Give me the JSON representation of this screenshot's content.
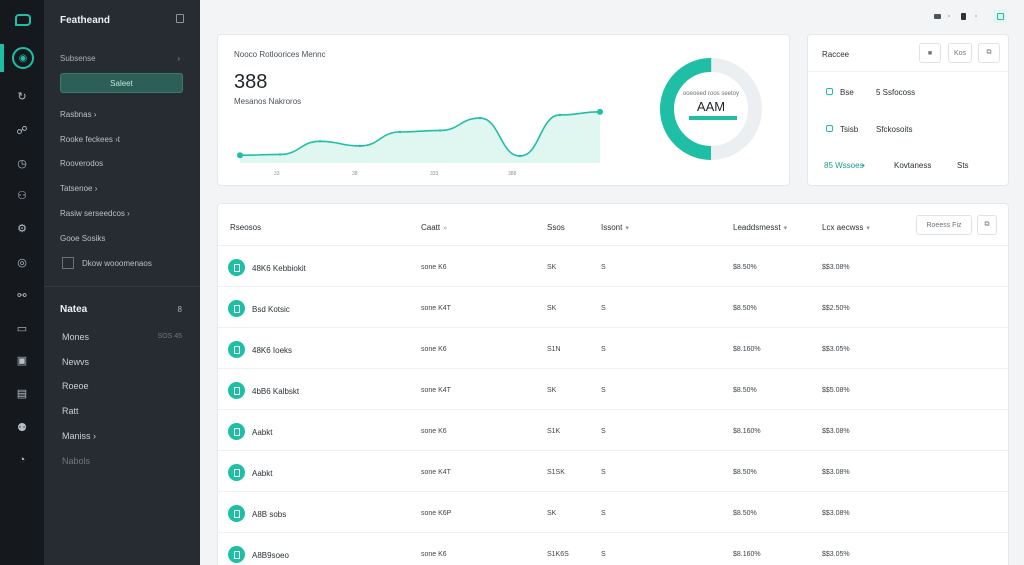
{
  "sidebar": {
    "title": "Featheand",
    "section": "Subsense",
    "section_chevron": "›",
    "primary_button": "Saleet",
    "items": [
      "Rasbnas ›",
      "Rooke feckees ›t",
      "Rooverodos",
      "Tatsenoe ›",
      "Rasiw serseedcos ›",
      "Gooe Sosiks",
      "Dkow wooomenaos"
    ],
    "group_title": "Natea",
    "group_count": "8",
    "subitems": [
      {
        "label": "Mones",
        "meta": "SOS 45"
      },
      {
        "label": "Newvs",
        "meta": ""
      },
      {
        "label": "Roeoe",
        "meta": ""
      },
      {
        "label": "Ratt",
        "meta": ""
      },
      {
        "label": "Maniss ›",
        "meta": ""
      },
      {
        "label": "Nabols",
        "meta": ""
      }
    ]
  },
  "metric_card": {
    "title": "Nooco Rotloorices Mennc",
    "value": "388",
    "subtitle": "Mesanos Nakroros"
  },
  "chart_data": {
    "type": "area",
    "x": [
      0,
      1,
      2,
      3,
      4,
      5,
      6,
      7,
      8,
      9
    ],
    "values": [
      10,
      11,
      28,
      22,
      40,
      42,
      58,
      9,
      62,
      66
    ],
    "tick_labels": [
      "33",
      "38",
      "333",
      "388"
    ],
    "ylim": [
      0,
      80
    ],
    "grid": false,
    "legend": "none",
    "title": "",
    "xlabel": "",
    "ylabel": ""
  },
  "donut": {
    "label": "ooeoeed roos seetoy",
    "value": "AAM",
    "percent": 50
  },
  "side_card": {
    "title": "Raccee",
    "btn_label": "Kos",
    "rows": [
      {
        "a": "Bse",
        "b": "5 Ssfocoss"
      },
      {
        "a": "Tsisb",
        "b": "Sfckosoits"
      }
    ],
    "footer": {
      "a": "85 Wssoes",
      "b": "Kovtaness",
      "c": "Sts"
    }
  },
  "table": {
    "columns": [
      "Rseosos",
      "Caatt",
      "Ssos",
      "Issont",
      "Leaddsmesst",
      "Lcx aecwss"
    ],
    "sort_glyph": "▾",
    "sort_glyph_alt": "»",
    "filter_label": "Roeess Fiz",
    "rows": [
      {
        "name": "48K6 Kebbiokit",
        "date": "sone K6",
        "size": "SK",
        "status": "S",
        "a": "$8.50%",
        "b": "$$3.08%"
      },
      {
        "name": "Bsd Kotsic",
        "date": "sone K4T",
        "size": "SK",
        "status": "S",
        "a": "$8.50%",
        "b": "$$2.50%"
      },
      {
        "name": "48K6 Ioeks",
        "date": "sone K6",
        "size": "S1N",
        "status": "S",
        "a": "$8.160%",
        "b": "$$3.05%"
      },
      {
        "name": "4bB6 Kalbskt",
        "date": "sone K4T",
        "size": "SK",
        "status": "S",
        "a": "$8.50%",
        "b": "$$5.08%"
      },
      {
        "name": "Aabkt",
        "date": "sone K6",
        "size": "S1K",
        "status": "S",
        "a": "$8.160%",
        "b": "$$3.08%"
      },
      {
        "name": "Aabkt",
        "date": "sone K4T",
        "size": "S1SK",
        "status": "S",
        "a": "$8.50%",
        "b": "$$3.08%"
      },
      {
        "name": "A8B sobs",
        "date": "sone K6P",
        "size": "SK",
        "status": "S",
        "a": "$8.50%",
        "b": "$$3.08%"
      },
      {
        "name": "A8B9soeo",
        "date": "sone K6",
        "size": "S1K6S",
        "status": "S",
        "a": "$8.160%",
        "b": "$$3.05%"
      }
    ]
  },
  "colors": {
    "accent": "#1fbfa5",
    "sidebar": "#262c32",
    "rail": "#15191d"
  },
  "icons": [
    "logo-icon",
    "dashboard-icon",
    "users-icon",
    "clock-icon",
    "globe-icon",
    "settings-icon",
    "card-icon"
  ]
}
